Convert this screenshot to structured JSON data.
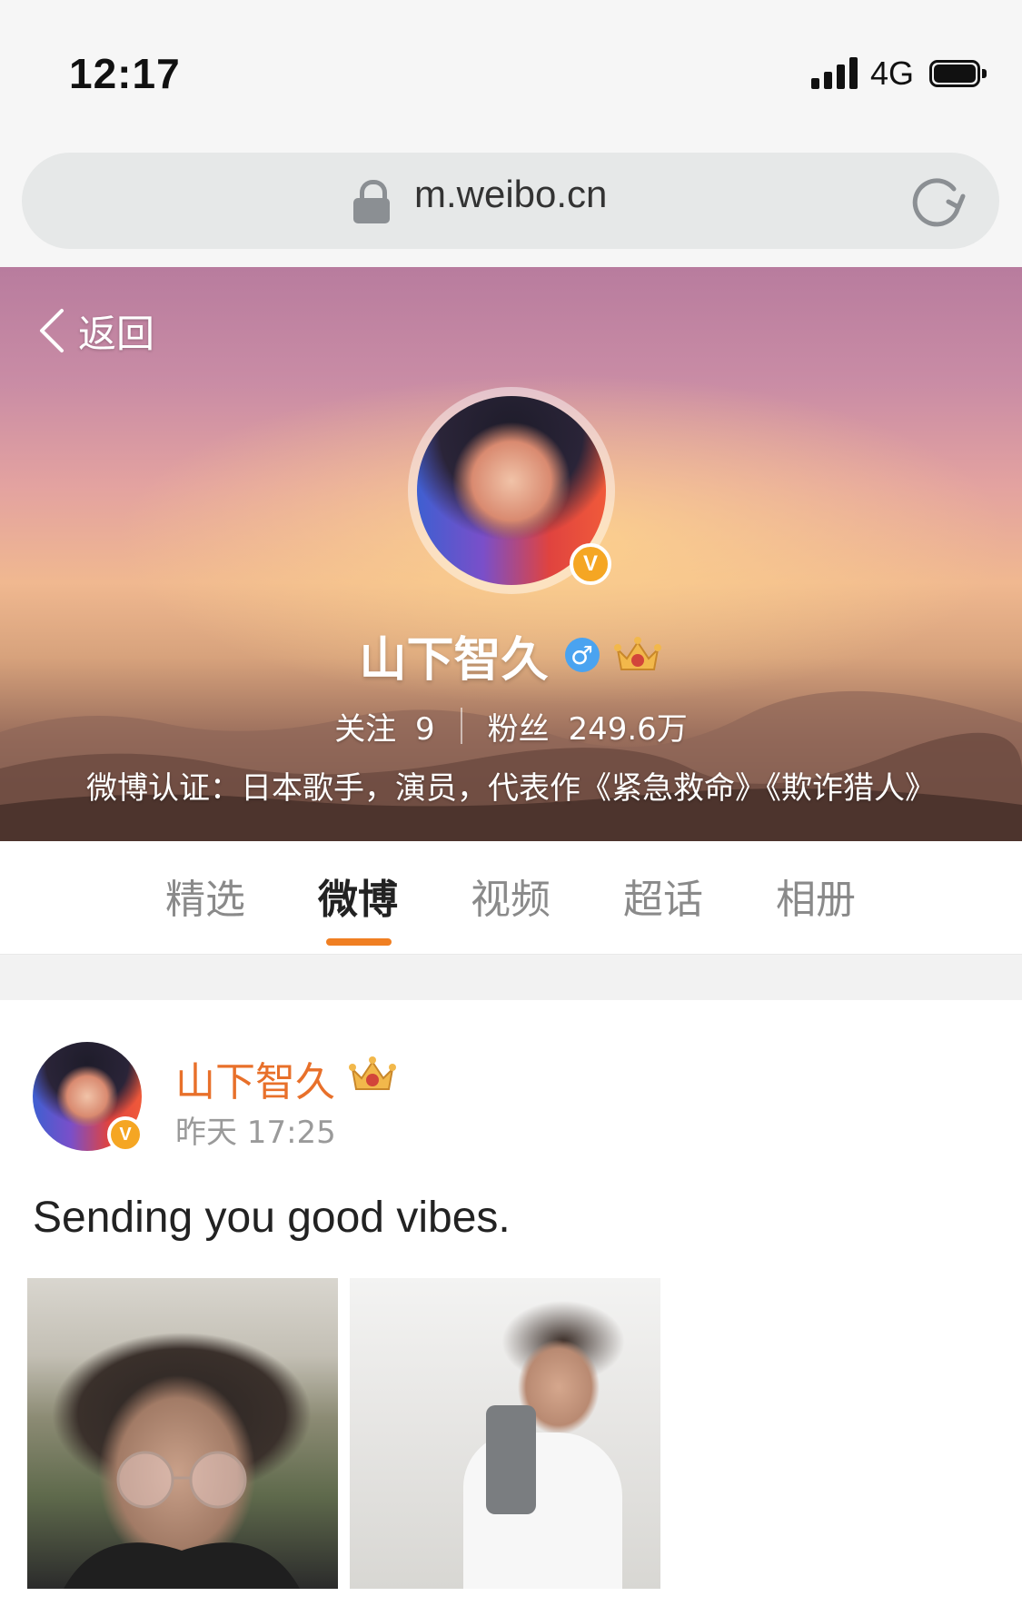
{
  "status_bar": {
    "time": "12:17",
    "network": "4G",
    "battery_level": 0.9
  },
  "browser": {
    "url": "m.weibo.cn"
  },
  "profile": {
    "back_label": "返回",
    "name": "山下智久",
    "following_label": "关注",
    "following_count": "9",
    "followers_label": "粉丝",
    "followers_count": "249.6万",
    "verification": "微博认证：日本歌手，演员，代表作《紧急救命》《欺诈猎人》",
    "verified_badge": "V",
    "gender_symbol": "♂"
  },
  "tabs": [
    {
      "label": "精选",
      "active": false
    },
    {
      "label": "微博",
      "active": true
    },
    {
      "label": "视频",
      "active": false
    },
    {
      "label": "超话",
      "active": false
    },
    {
      "label": "相册",
      "active": false
    }
  ],
  "post": {
    "author": "山下智久",
    "time": "昨天 17:25",
    "text": "Sending you good vibes.",
    "images": [
      "selfie-balcony-photo",
      "mirror-selfie-photo"
    ]
  },
  "colors": {
    "accent": "#f07f22",
    "author_name": "#e8702a",
    "verified": "#f5a623"
  }
}
